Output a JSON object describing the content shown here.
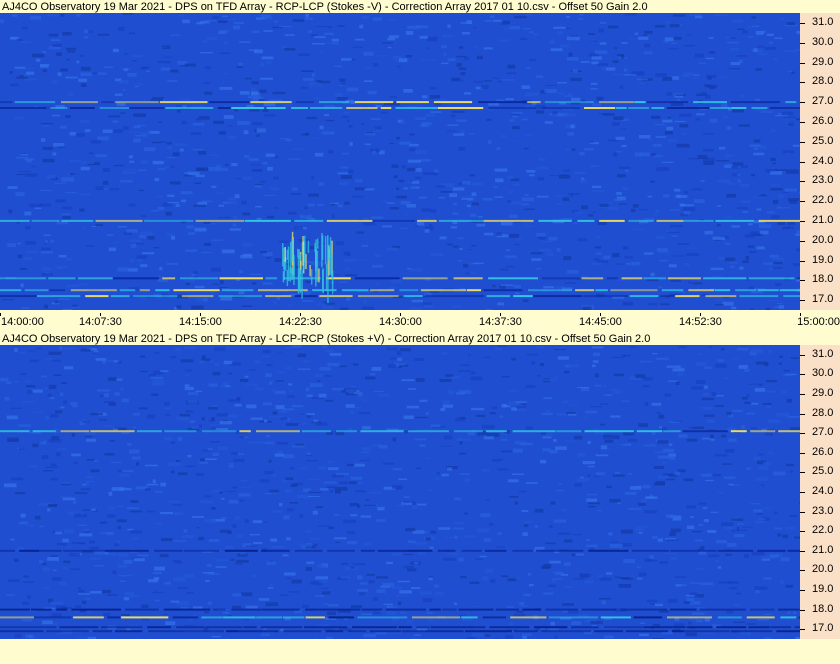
{
  "panels": [
    {
      "title": "AJ4CO Observatory 19 Mar 2021  -  DPS on TFD Array  -  RCP-LCP (Stokes -V)  -  Correction Array 2017 01 10.csv  -  Offset 50  Gain 2.0"
    },
    {
      "title": "AJ4CO Observatory 19 Mar 2021  -  DPS on TFD Array  -  LCP-RCP (Stokes +V)  -  Correction Array 2017 01 10.csv  -  Offset 50  Gain 2.0"
    }
  ],
  "chart_data": [
    {
      "type": "heatmap",
      "title": "AJ4CO Observatory 19 Mar 2021  -  DPS on TFD Array  -  RCP-LCP (Stokes -V)  -  Correction Array 2017 01 10.csv  -  Offset 50  Gain 2.0",
      "x_ticks": [
        "14:00:00",
        "14:07:30",
        "14:15:00",
        "14:22:30",
        "14:30:00",
        "14:37:30",
        "14:45:00",
        "14:52:30",
        "15:00:00"
      ],
      "xlim": [
        "14:00:00",
        "15:00:00"
      ],
      "y_ticks": [
        17.0,
        18.0,
        19.0,
        20.0,
        21.0,
        22.0,
        23.0,
        24.0,
        25.0,
        26.0,
        27.0,
        28.0,
        29.0,
        30.0,
        31.0
      ],
      "ylim": [
        16.5,
        31.5
      ],
      "colors": {
        "background": "#1f4fd0",
        "dark": "#0a2aa0",
        "bright": "#33c6e0",
        "hot": "#f0e060"
      },
      "features": [
        {
          "freq": 17.2,
          "kind": "interference-line"
        },
        {
          "freq": 17.5,
          "kind": "interference-line"
        },
        {
          "freq": 18.1,
          "kind": "interference-line"
        },
        {
          "freq": 21.0,
          "kind": "interference-line"
        },
        {
          "freq": 26.7,
          "kind": "interference-line"
        },
        {
          "freq": 27.0,
          "kind": "interference-line"
        },
        {
          "time_start": "14:21:00",
          "time_end": "14:25:00",
          "freq_low": 17.0,
          "freq_high": 20.5,
          "kind": "burst"
        }
      ]
    },
    {
      "type": "heatmap",
      "title": "AJ4CO Observatory 19 Mar 2021  -  DPS on TFD Array  -  LCP-RCP (Stokes +V)  -  Correction Array 2017 01 10.csv  -  Offset 50  Gain 2.0",
      "x_ticks": [],
      "xlim": [
        "14:00:00",
        "15:00:00"
      ],
      "y_ticks": [
        17.0,
        18.0,
        19.0,
        20.0,
        21.0,
        22.0,
        23.0,
        24.0,
        25.0,
        26.0,
        27.0,
        28.0,
        29.0,
        30.0,
        31.0
      ],
      "ylim": [
        16.5,
        31.5
      ],
      "colors": {
        "background": "#1f4fd0",
        "dark": "#082290",
        "bright": "#33c6e0",
        "hot": "#f0e060"
      },
      "features": [
        {
          "freq": 16.9,
          "kind": "dark-line"
        },
        {
          "freq": 17.1,
          "kind": "dark-line"
        },
        {
          "freq": 17.6,
          "kind": "interference-line"
        },
        {
          "freq": 18.0,
          "kind": "dark-line"
        },
        {
          "freq": 21.0,
          "kind": "dark-line"
        },
        {
          "freq": 27.1,
          "kind": "interference-line"
        }
      ]
    }
  ]
}
